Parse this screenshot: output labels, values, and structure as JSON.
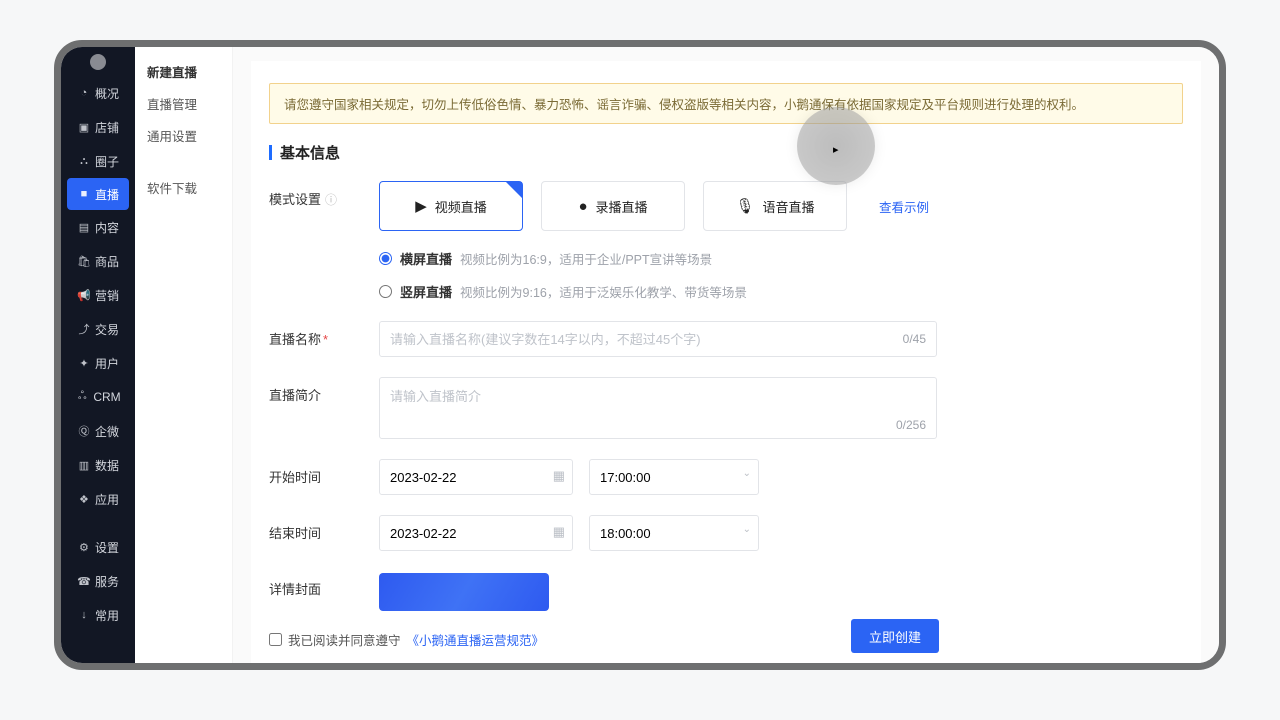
{
  "sidebar": {
    "items": [
      {
        "icon": "◔",
        "label": "概况"
      },
      {
        "icon": "▣",
        "label": "店铺"
      },
      {
        "icon": "⛬",
        "label": "圈子"
      },
      {
        "icon": "■",
        "label": "直播"
      },
      {
        "icon": "▤",
        "label": "内容"
      },
      {
        "icon": "🛍",
        "label": "商品"
      },
      {
        "icon": "📢",
        "label": "营销"
      },
      {
        "icon": "⤴",
        "label": "交易"
      },
      {
        "icon": "✦",
        "label": "用户"
      },
      {
        "icon": "ஃ",
        "label": "CRM"
      },
      {
        "icon": "Ⓠ",
        "label": "企微"
      },
      {
        "icon": "▥",
        "label": "数据"
      },
      {
        "icon": "❖",
        "label": "应用"
      }
    ],
    "bottom": [
      {
        "icon": "⚙",
        "label": "设置"
      },
      {
        "icon": "☎",
        "label": "服务"
      },
      {
        "icon": "↓",
        "label": "常用"
      }
    ]
  },
  "subnav": {
    "items": [
      {
        "label": "新建直播",
        "active": true
      },
      {
        "label": "直播管理"
      },
      {
        "label": "通用设置"
      }
    ],
    "separated": {
      "label": "软件下载"
    }
  },
  "warning": "请您遵守国家相关规定，切勿上传低俗色情、暴力恐怖、谣言诈骗、侵权盗版等相关内容，小鹅通保有依据国家规定及平台规则进行处理的权利。",
  "section_title": "基本信息",
  "mode": {
    "label": "模式设置",
    "cards": [
      {
        "icon": "▶",
        "label": "视频直播",
        "selected": true
      },
      {
        "icon": "●",
        "label": "录播直播",
        "selected": false
      },
      {
        "icon": "🎙",
        "label": "语音直播",
        "selected": false
      }
    ],
    "demo_link": "查看示例",
    "orientation": [
      {
        "name": "横屏直播",
        "desc": "视频比例为16:9，适用于企业/PPT宣讲等场景",
        "checked": true
      },
      {
        "name": "竖屏直播",
        "desc": "视频比例为9:16，适用于泛娱乐化教学、带货等场景",
        "checked": false
      }
    ]
  },
  "name_field": {
    "label": "直播名称",
    "placeholder": "请输入直播名称(建议字数在14字以内，不超过45个字)",
    "counter": "0/45"
  },
  "intro_field": {
    "label": "直播简介",
    "placeholder": "请输入直播简介",
    "counter": "0/256"
  },
  "start": {
    "label": "开始时间",
    "date": "2023-02-22",
    "time": "17:00:00"
  },
  "end": {
    "label": "结束时间",
    "date": "2023-02-22",
    "time": "18:00:00"
  },
  "cover": {
    "label": "详情封面"
  },
  "agree": {
    "text": "我已阅读并同意遵守",
    "link": "《小鹅通直播运营规范》"
  },
  "create_btn": "立即创建"
}
